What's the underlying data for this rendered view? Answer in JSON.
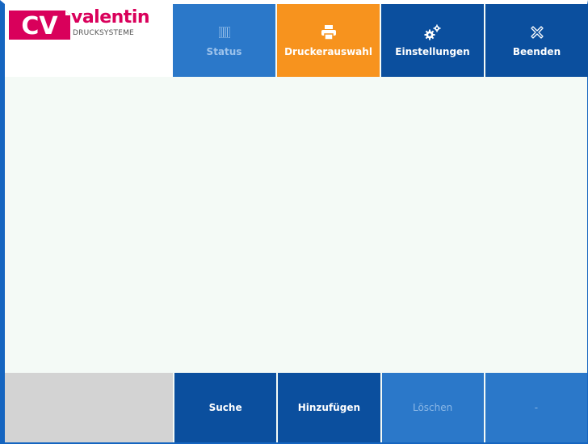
{
  "logo": {
    "badge_text": "CV",
    "name": "valentin",
    "subtitle": "DRUCKSYSTEME",
    "brand_color": "#d9005b"
  },
  "topnav": {
    "items": [
      {
        "label": "Status",
        "icon": "status-bars-icon",
        "enabled": false
      },
      {
        "label": "Druckerauswahl",
        "icon": "printer-icon",
        "active": true
      },
      {
        "label": "Einstellungen",
        "icon": "gears-icon"
      },
      {
        "label": "Beenden",
        "icon": "close-icon"
      }
    ]
  },
  "bottombar": {
    "items": [
      {
        "label": "Suche",
        "enabled": true
      },
      {
        "label": "Hinzufügen",
        "enabled": true
      },
      {
        "label": "Löschen",
        "enabled": false
      },
      {
        "label": "-",
        "enabled": false
      }
    ]
  },
  "colors": {
    "active_tab": "#f7931e",
    "dark_blue": "#0b4f9e",
    "light_blue": "#2b78c9",
    "content_bg": "#f4faf6"
  }
}
